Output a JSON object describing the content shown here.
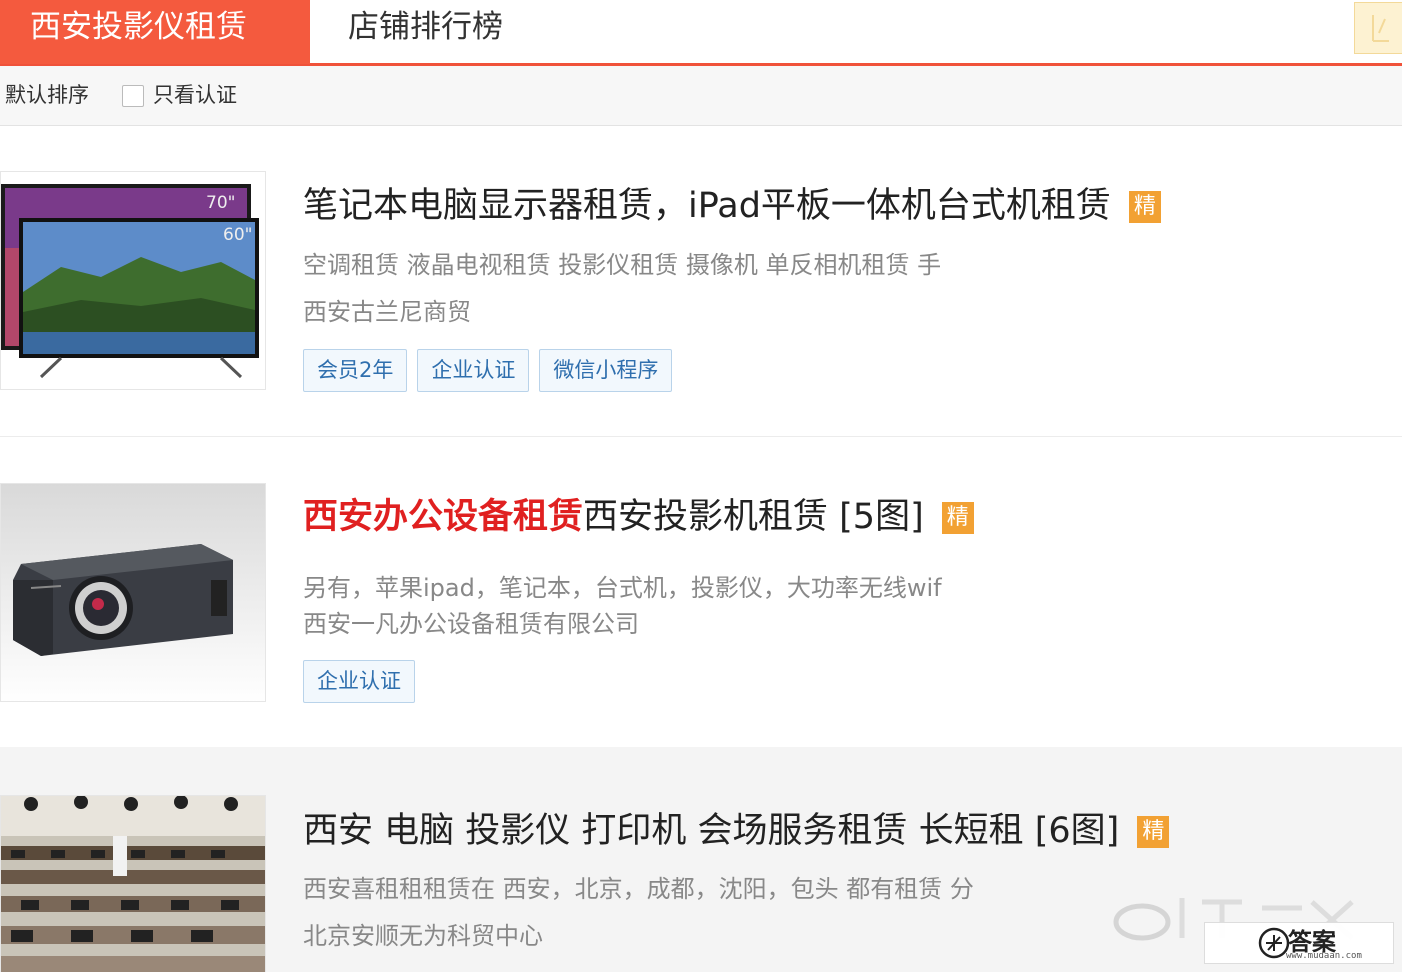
{
  "tabs": {
    "active_label": "西安投影仪租赁",
    "second_label": "店铺排行榜"
  },
  "filters": {
    "sort_label": "默认排序",
    "certified_only_label": "只看认证"
  },
  "listings": [
    {
      "title": "笔记本电脑显示器租赁，iPad平板一体机台式机租赁",
      "badge": "精",
      "desc": "空调租赁 液晶电视租赁 投影仪租赁 摄像机 单反相机租赁 手",
      "company": "西安古兰尼商贸",
      "tags": [
        "会员2年",
        "企业认证",
        "微信小程序"
      ],
      "thumb_labels": [
        "70\"",
        "60\""
      ]
    },
    {
      "title_highlight": "西安办公设备租赁",
      "title_rest": "西安投影机租赁 [5图]",
      "badge": "精",
      "desc": "另有，苹果ipad，笔记本，台式机，投影仪，大功率无线wif",
      "company": "西安一凡办公设备租赁有限公司",
      "tags": [
        "企业认证"
      ]
    },
    {
      "title": "西安 电脑 投影仪 打印机 会场服务租赁 长短租 [6图]",
      "badge": "精",
      "desc": "西安喜租租租赁在 西安，北京，成都，沈阳，包头 都有租赁 分",
      "company": "北京安顺无为科贸中心"
    }
  ],
  "watermark": {
    "logo_text": "答案",
    "url": "www.mudaan.com"
  },
  "colors": {
    "accent": "#f45a3e",
    "badge": "#f2a133",
    "highlight": "#e02020",
    "tag_text": "#2f6fae"
  }
}
